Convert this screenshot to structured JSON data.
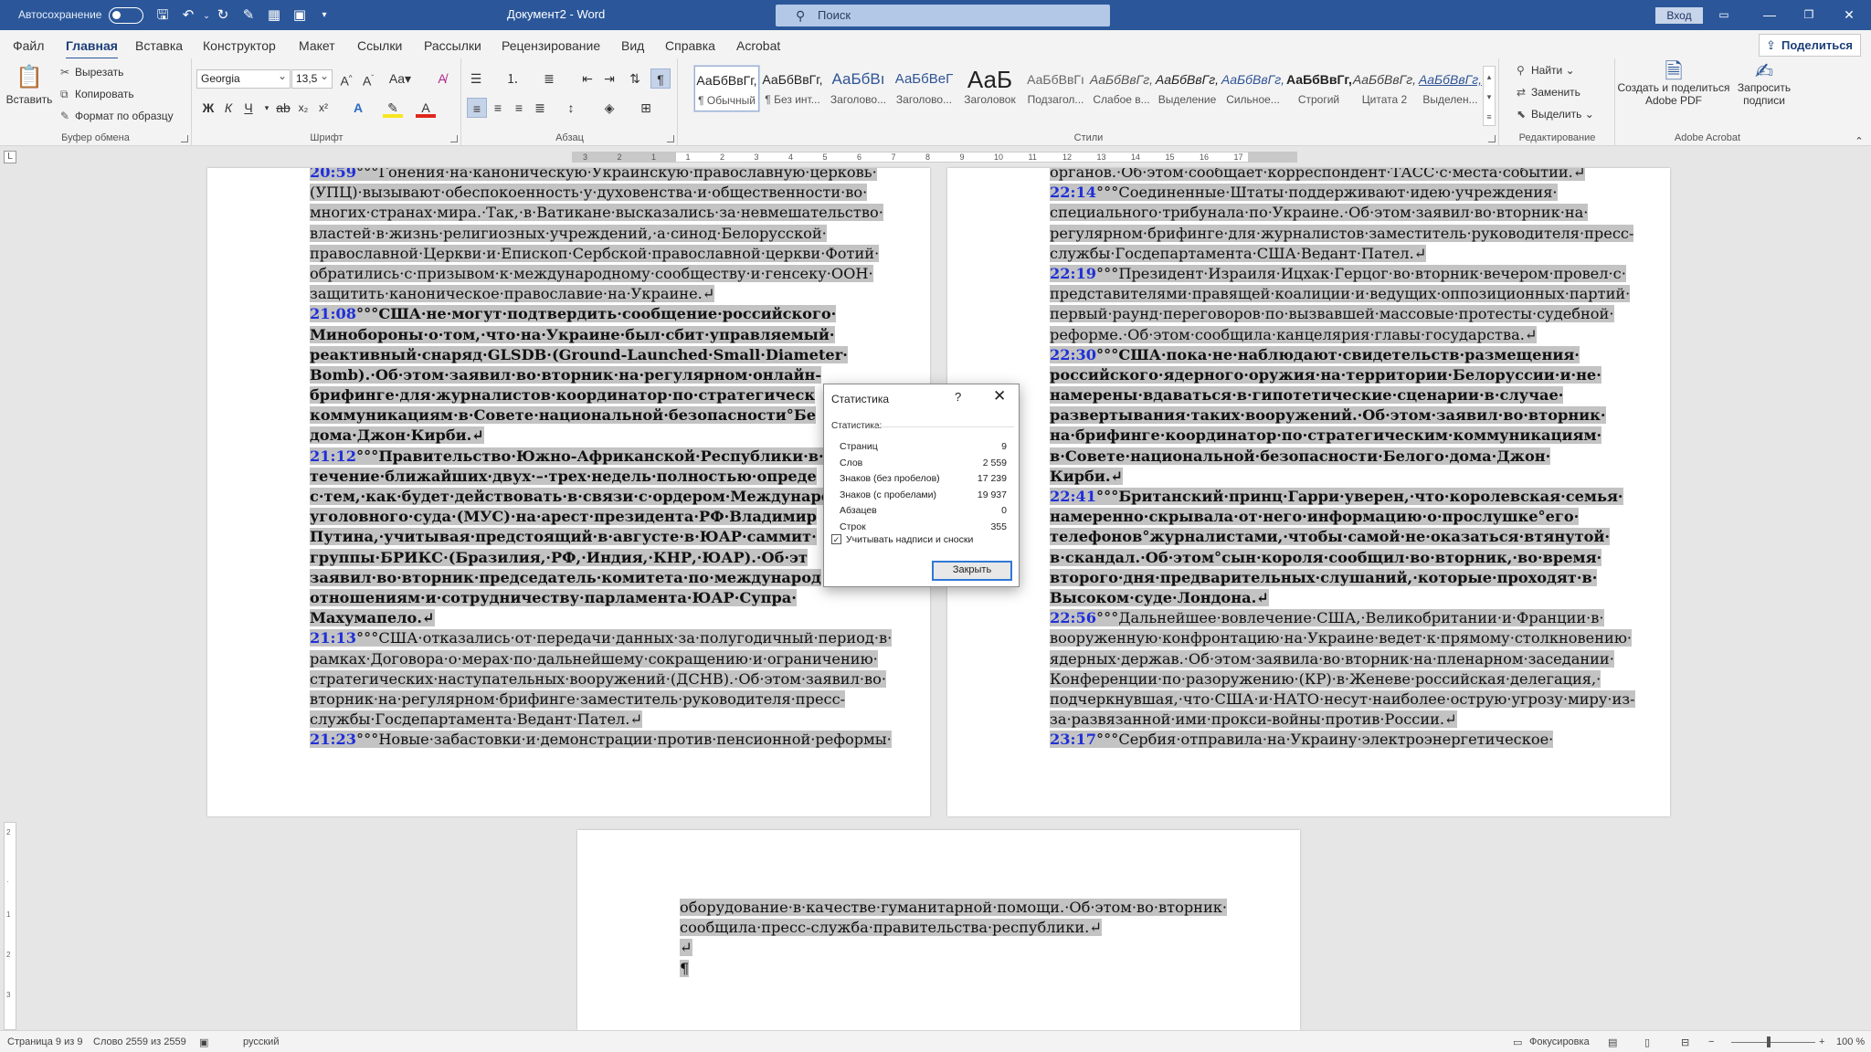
{
  "titlebar": {
    "autosave": "Автосохранение",
    "doc_title": "Документ2 - Word",
    "search_placeholder": "Поиск",
    "signin": "Вход"
  },
  "tabs": [
    "Файл",
    "Главная",
    "Вставка",
    "Конструктор",
    "Макет",
    "Ссылки",
    "Рассылки",
    "Рецензирование",
    "Вид",
    "Справка",
    "Acrobat"
  ],
  "share": "Поделиться",
  "ribbon": {
    "clipboard": {
      "paste": "Вставить",
      "cut": "Вырезать",
      "copy": "Копировать",
      "painter": "Формат по образцу",
      "label": "Буфер обмена"
    },
    "font": {
      "name": "Georgia",
      "size": "13,5",
      "label": "Шрифт"
    },
    "paragraph": {
      "label": "Абзац"
    },
    "styles": {
      "label": "Стили",
      "items": [
        {
          "sample": "АаБбВвГг,",
          "name": "¶ Обычный"
        },
        {
          "sample": "АаБбВвГг,",
          "name": "¶ Без инт..."
        },
        {
          "sample": "АаБбВı",
          "name": "Заголово..."
        },
        {
          "sample": "АаБбВеГ",
          "name": "Заголово..."
        },
        {
          "sample": "АаБ",
          "name": "Заголовок"
        },
        {
          "sample": "АаБбВвГı",
          "name": "Подзагол..."
        },
        {
          "sample": "АаБбВвГг,",
          "name": "Слабое в..."
        },
        {
          "sample": "АаБбВвГг,",
          "name": "Выделение"
        },
        {
          "sample": "АаБбВвГг,",
          "name": "Сильное..."
        },
        {
          "sample": "АаБбВвГг,",
          "name": "Строгий"
        },
        {
          "sample": "АаБбВвГг,",
          "name": "Цитата 2"
        },
        {
          "sample": "АаБбВвГг,",
          "name": "Выделен..."
        }
      ]
    },
    "editing": {
      "find": "Найти",
      "replace": "Заменить",
      "select": "Выделить",
      "label": "Редактирование"
    },
    "acrobat": {
      "create": "Создать и поделиться",
      "create2": "Adobe PDF",
      "request": "Запросить",
      "request2": "подписи",
      "label": "Adobe Acrobat"
    }
  },
  "ruler": {
    "ticks": [
      "3",
      "2",
      "1",
      "1",
      "2",
      "3",
      "4",
      "5",
      "6",
      "7",
      "8",
      "9",
      "10",
      "11",
      "12",
      "13",
      "14",
      "15",
      "16",
      "17"
    ]
  },
  "page_left": {
    "lines": [
      [
        {
          "t": "20:59",
          "c": "t"
        },
        {
          "t": "°°°Гонения·на·каноническую·Украинскую·православную·церковь·"
        }
      ],
      [
        {
          "t": "(УПЦ)·вызывают·обеспокоенность·у·духовенства·и·общественности·во·"
        }
      ],
      [
        {
          "t": "многих·странах·мира.·Так,·в·Ватикане·высказались·за·невмешательство·"
        }
      ],
      [
        {
          "t": "властей·в·жизнь·религиозных·учреждений,·а·синод·Белорусской·"
        }
      ],
      [
        {
          "t": "православной·Церкви·и·Епископ·Сербской·православной·церкви·Фотий·"
        }
      ],
      [
        {
          "t": "обратились·с·призывом·к·международному·сообществу·и·генсеку·ООН·"
        }
      ],
      [
        {
          "t": "защитить·каноническое·православие·на·Украине.↵"
        }
      ],
      [
        {
          "t": "21:08",
          "c": "t"
        },
        {
          "t": "°°°США·не·могут·подтвердить·сообщение·российского·",
          "c": "b"
        }
      ],
      [
        {
          "t": "Минобороны·о·том,·что·на·Украине·был·сбит·управляемый·",
          "c": "b"
        }
      ],
      [
        {
          "t": "реактивный·снаряд·GLSDB·(Ground-Launched·Small·Diameter·",
          "c": "b"
        }
      ],
      [
        {
          "t": "Bomb).·Об·этом·заявил·во·вторник·на·регулярном·онлайн-",
          "c": "b"
        }
      ],
      [
        {
          "t": "брифинге·для·журналистов·координатор·по·стратегическ",
          "c": "b"
        }
      ],
      [
        {
          "t": "коммуникациям·в·Совете·национальной·безопасности°Бе",
          "c": "b"
        }
      ],
      [
        {
          "t": "дома·Джон·Кирби.↵",
          "c": "b"
        }
      ],
      [
        {
          "t": "21:12",
          "c": "t"
        },
        {
          "t": "°°°Правительство·Южно-Африканской·Республики·в·",
          "c": "b"
        }
      ],
      [
        {
          "t": "течение·ближайших·двух·–·трех·недель·полностью·опреде",
          "c": "b"
        }
      ],
      [
        {
          "t": "с·тем,·как·будет·действовать·в·связи·с·ордером·Междунаро",
          "c": "b"
        }
      ],
      [
        {
          "t": "уголовного·суда·(МУС)·на·арест·президента·РФ·Владимир",
          "c": "b"
        }
      ],
      [
        {
          "t": "Путина,·учитывая·предстоящий·в·августе·в·ЮАР·саммит·",
          "c": "b"
        }
      ],
      [
        {
          "t": "группы·БРИКС·(Бразилия,·РФ,·Индия,·КНР,·ЮАР).·Об·эт",
          "c": "b"
        }
      ],
      [
        {
          "t": "заявил·во·вторник·председатель·комитета·по·международ",
          "c": "b"
        }
      ],
      [
        {
          "t": "отношениям·и·сотрудничеству·парламента·ЮАР·Супра·",
          "c": "b"
        }
      ],
      [
        {
          "t": "Махумапело.↵",
          "c": "b"
        }
      ],
      [
        {
          "t": "21:13",
          "c": "t"
        },
        {
          "t": "°°°США·отказались·от·передачи·данных·за·полугодичный·период·в·"
        }
      ],
      [
        {
          "t": "рамках·Договора·о·мерах·по·дальнейшему·сокращению·и·ограничению·"
        }
      ],
      [
        {
          "t": "стратегических·наступательных·вооружений·(ДСНВ).·Об·этом·заявил·во·"
        }
      ],
      [
        {
          "t": "вторник·на·регулярном·брифинге·заместитель·руководителя·пресс-"
        }
      ],
      [
        {
          "t": "службы·Госдепартамента·Ведант·Пател.↵"
        }
      ],
      [
        {
          "t": "21:23",
          "c": "t"
        },
        {
          "t": "°°°Новые·забастовки·и·демонстрации·против·пенсионной·реформы·"
        }
      ]
    ]
  },
  "page_right": {
    "lines": [
      [
        {
          "t": "органов.·Об·этом·сообщает·корреспондент·ТАСС·с·места·событий.↵"
        }
      ],
      [
        {
          "t": "22:14",
          "c": "t"
        },
        {
          "t": "°°°Соединенные·Штаты·поддерживают·идею·учреждения·"
        }
      ],
      [
        {
          "t": "специального·трибунала·по·Украине.·Об·этом·заявил·во·вторник·на·"
        }
      ],
      [
        {
          "t": "регулярном·брифинге·для·журналистов·заместитель·руководителя·пресс-"
        }
      ],
      [
        {
          "t": "службы·Госдепартамента·США·Ведант·Пател.↵"
        }
      ],
      [
        {
          "t": "22:19",
          "c": "t"
        },
        {
          "t": "°°°Президент·Израиля·Ицхак·Герцог·во·вторник·вечером·провел·с·"
        }
      ],
      [
        {
          "t": "представителями·правящей·коалиции·и·ведущих·оппозиционных·партий·"
        }
      ],
      [
        {
          "t": "первый·раунд·переговоров·по·вызвавшей·массовые·протесты·судебной·"
        }
      ],
      [
        {
          "t": "реформе.·Об·этом·сообщила·канцелярия·главы·государства.↵"
        }
      ],
      [
        {
          "t": "22:30",
          "c": "t"
        },
        {
          "t": "°°°США·пока·не·наблюдают·свидетельств·размещения·",
          "c": "b"
        }
      ],
      [
        {
          "t": "российского·ядерного·оружия·на·территории·Белоруссии·и·не·",
          "c": "b"
        }
      ],
      [
        {
          "t": "намерены·вдаваться·в·гипотетические·сценарии·в·случае·",
          "c": "b"
        }
      ],
      [
        {
          "t": "развертывания·таких·вооружений.·Об·этом·заявил·во·вторник·",
          "c": "b"
        }
      ],
      [
        {
          "t": "на·брифинге·координатор·по·стратегическим·коммуникациям·",
          "c": "b"
        }
      ],
      [
        {
          "t": "в·Совете·национальной·безопасности·Белого·дома·Джон·",
          "c": "b"
        }
      ],
      [
        {
          "t": "Кирби.↵",
          "c": "b"
        }
      ],
      [
        {
          "t": "22:41",
          "c": "t"
        },
        {
          "t": "°°°Британский·принц·Гарри·уверен,·что·королевская·семья·",
          "c": "b"
        }
      ],
      [
        {
          "t": "намеренно·скрывала·от·него·информацию·о·прослушке°его·",
          "c": "b"
        }
      ],
      [
        {
          "t": "телефонов°журналистами,·чтобы·самой·не·оказаться·втянутой·",
          "c": "b"
        }
      ],
      [
        {
          "t": "в·скандал.·Об·этом°сын·короля·сообщил·во·вторник,·во·время·",
          "c": "b"
        }
      ],
      [
        {
          "t": "второго·дня·предварительных·слушаний,·которые·проходят·в·",
          "c": "b"
        }
      ],
      [
        {
          "t": "Высоком·суде·Лондона.↵",
          "c": "b"
        }
      ],
      [
        {
          "t": "22:56",
          "c": "t"
        },
        {
          "t": "°°°Дальнейшее·вовлечение·США,·Великобритании·и·Франции·в·"
        }
      ],
      [
        {
          "t": "вооруженную·конфронтацию·на·Украине·ведет·к·прямому·столкновению·"
        }
      ],
      [
        {
          "t": "ядерных·держав.·Об·этом·заявила·во·вторник·на·пленарном·заседании·"
        }
      ],
      [
        {
          "t": "Конференции·по·разоружению·(КР)·в·Женеве·российская·делегация,·"
        }
      ],
      [
        {
          "t": "подчеркнувшая,·что·США·и·НАТО·несут·наиболее·острую·угрозу·миру·из-"
        }
      ],
      [
        {
          "t": "за·развязанной·ими·прокси-войны·против·России.↵"
        }
      ],
      [
        {
          "t": "23:17",
          "c": "t"
        },
        {
          "t": "°°°Сербия·отправила·на·Украину·электроэнергетическое·"
        }
      ]
    ]
  },
  "page_bottom": {
    "lines": [
      [
        {
          "t": "оборудование·в·качестве·гуманитарной·помощи.·Об·этом·во·вторник·"
        }
      ],
      [
        {
          "t": "сообщила·пресс-служба·правительства·республики.↵"
        }
      ],
      [
        {
          "t": "↵"
        }
      ],
      [
        {
          "t": "¶"
        }
      ]
    ]
  },
  "dialog": {
    "title": "Статистика",
    "help": "?",
    "close_x": "✕",
    "section": "Статистика:",
    "rows": [
      {
        "label": "Страниц",
        "value": "9"
      },
      {
        "label": "Слов",
        "value": "2 559"
      },
      {
        "label": "Знаков (без пробелов)",
        "value": "17 239"
      },
      {
        "label": "Знаков (с пробелами)",
        "value": "19 937"
      },
      {
        "label": "Абзацев",
        "value": "0"
      },
      {
        "label": "Строк",
        "value": "355"
      }
    ],
    "checkbox_label": "Учитывать надписи и сноски",
    "checkbox_checked": true,
    "close_button": "Закрыть"
  },
  "status": {
    "page": "Страница 9 из 9",
    "words": "Слово 2559 из 2559",
    "lang": "русский",
    "focus": "Фокусировка",
    "zoom": "100 %"
  }
}
